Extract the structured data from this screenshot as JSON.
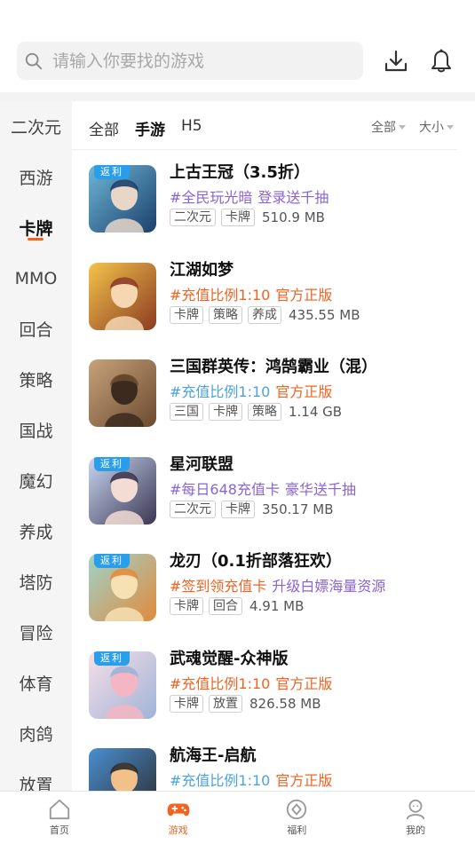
{
  "search": {
    "placeholder": "请输入你要找的游戏"
  },
  "header_icons": [
    "download-icon",
    "bell-icon"
  ],
  "sidebar": {
    "items": [
      {
        "label": "二次元"
      },
      {
        "label": "西游"
      },
      {
        "label": "卡牌"
      },
      {
        "label": "MMO"
      },
      {
        "label": "回合"
      },
      {
        "label": "策略"
      },
      {
        "label": "国战"
      },
      {
        "label": "魔幻"
      },
      {
        "label": "养成"
      },
      {
        "label": "塔防"
      },
      {
        "label": "冒险"
      },
      {
        "label": "体育"
      },
      {
        "label": "肉鸽"
      },
      {
        "label": "放置"
      }
    ],
    "active": "卡牌"
  },
  "filters": {
    "tabs": [
      {
        "label": "全部"
      },
      {
        "label": "手游"
      },
      {
        "label": "H5"
      }
    ],
    "active_tab": "手游",
    "dropdowns": [
      {
        "label": "全部"
      },
      {
        "label": "大小"
      }
    ]
  },
  "badge_text": "返利",
  "games": [
    {
      "title": "上古王冠（3.5折）",
      "badge": "返利",
      "promo1": "#全民玩光暗",
      "promo2": "登录送千抽",
      "promo_color": "#8a63d2",
      "tags": [
        "二次元",
        "卡牌"
      ],
      "size": "510.9 MB"
    },
    {
      "title": "江湖如梦",
      "badge": "",
      "promo1": "#充值比例1:10",
      "promo2": "官方正版",
      "promo_color": "#f26322",
      "tags": [
        "卡牌",
        "策略",
        "养成"
      ],
      "size": "435.55 MB"
    },
    {
      "title": "三国群英传：鸿鹄霸业（混）",
      "badge": "",
      "promo1": "#充值比例1:10",
      "promo2": "官方正版",
      "promo_color": "#f26322",
      "tags": [
        "三国",
        "卡牌",
        "策略"
      ],
      "size": "1.14 GB"
    },
    {
      "title": "星河联盟",
      "badge": "返利",
      "promo1": "#每日648充值卡",
      "promo2": "豪华送千抽",
      "promo_color": "#8a63d2",
      "tags": [
        "二次元",
        "卡牌"
      ],
      "size": "350.17 MB"
    },
    {
      "title": "龙刃（0.1折部落狂欢）",
      "badge": "返利",
      "promo1": "#签到领充值卡",
      "promo2": "升级白嫖海量资源",
      "promo_color": "#8a63d2",
      "tags": [
        "卡牌",
        "回合"
      ],
      "size": "4.91 MB"
    },
    {
      "title": "武魂觉醒-众神版",
      "badge": "返利",
      "promo1": "#充值比例1:10",
      "promo2": "官方正版",
      "promo_color": "#f26322",
      "tags": [
        "卡牌",
        "放置"
      ],
      "size": "826.58 MB"
    },
    {
      "title": "航海王-启航",
      "badge": "",
      "promo1": "#充值比例1:10",
      "promo2": "官方正版",
      "promo_color": "#f26322",
      "tags": [],
      "size": ""
    }
  ],
  "bottom_nav": [
    {
      "label": "首页",
      "icon": "home-icon"
    },
    {
      "label": "游戏",
      "icon": "gamepad-icon"
    },
    {
      "label": "福利",
      "icon": "welfare-icon"
    },
    {
      "label": "我的",
      "icon": "profile-icon"
    }
  ],
  "colors": {
    "accent": "#f26322",
    "promo_purple": "#8a63d2",
    "badge_blue": "#2a9ee8"
  }
}
